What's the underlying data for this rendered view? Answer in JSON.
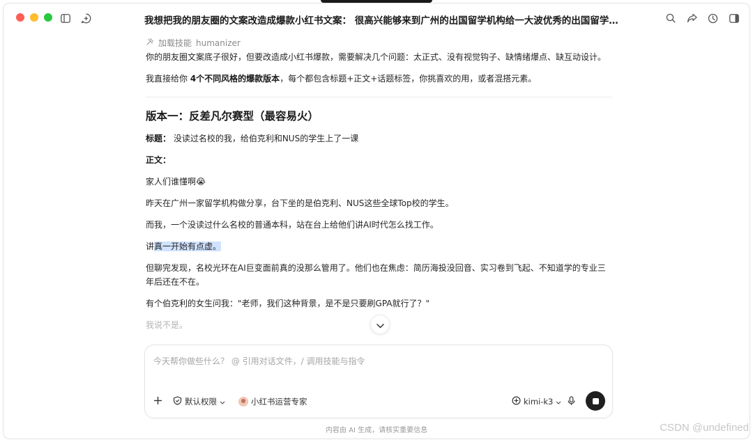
{
  "window": {
    "title": "我想把我的朋友圈的文案改造成爆款小红书文案： 很高兴能够来到广州的出国留学机构给一大波优秀的出国留学…"
  },
  "message": {
    "skill_prefix": "加载技能",
    "skill_name": "humanizer",
    "intro1": "你的朋友圈文案底子很好，但要改造成小红书爆款，需要解决几个问题：太正式、没有视觉钩子、缺情绪爆点、缺互动设计。",
    "intro2_a": "我直接给你 ",
    "intro2_b": "4个不同风格的爆款版本",
    "intro2_c": "，每个都包含标题+正文+话题标签，你挑喜欢的用，或者混搭元素。",
    "version_heading": "版本一：反差凡尔赛型（最容易火）",
    "title_label": "标题：",
    "title_text": " 没读过名校的我，给伯克利和NUS的学生上了一课",
    "body_label": "正文：",
    "line1": "家人们谁懂啊😭",
    "line2": "昨天在广州一家留学机构做分享，台下坐的是伯克利、NUS这些全球Top校的学生。",
    "line3": "而我，一个没读过什么名校的普通本科，站在台上给他们讲AI时代怎么找工作。",
    "line4_a": "讲",
    "line4_hl": "真一开始有点虚。",
    "line5": "但聊完发现，名校光环在AI巨变面前真的没那么管用了。他们也在焦虑：简历海投没回音、实习卷到飞起、不知道学的专业三年后还在不在。",
    "line6": "有个伯克利的女生问我：\"老师，我们这种背景，是不是只要刷GPA就行了？\"",
    "line7": "我说不是。"
  },
  "composer": {
    "placeholder": "今天帮你做些什么？ @ 引用对话文件，/ 调用技能与指令",
    "permission_label": "默认权限",
    "agent_label": "小红书运营专家",
    "model_label": "kimi-k3"
  },
  "footer": {
    "disclaimer": "内容由 AI 生成，请核实重要信息",
    "watermark": "CSDN @undefined"
  },
  "icons": {
    "sidebar": "sidebar-icon",
    "new_chat": "new-chat-icon",
    "search": "search-icon",
    "share": "share-icon",
    "history": "history-icon",
    "panel": "panel-icon",
    "skill": "skill-icon",
    "chevron_down": "chevron-down-icon",
    "plus": "plus-icon",
    "shield": "shield-icon",
    "mic": "mic-icon",
    "stop": "stop-icon",
    "model": "model-icon"
  }
}
